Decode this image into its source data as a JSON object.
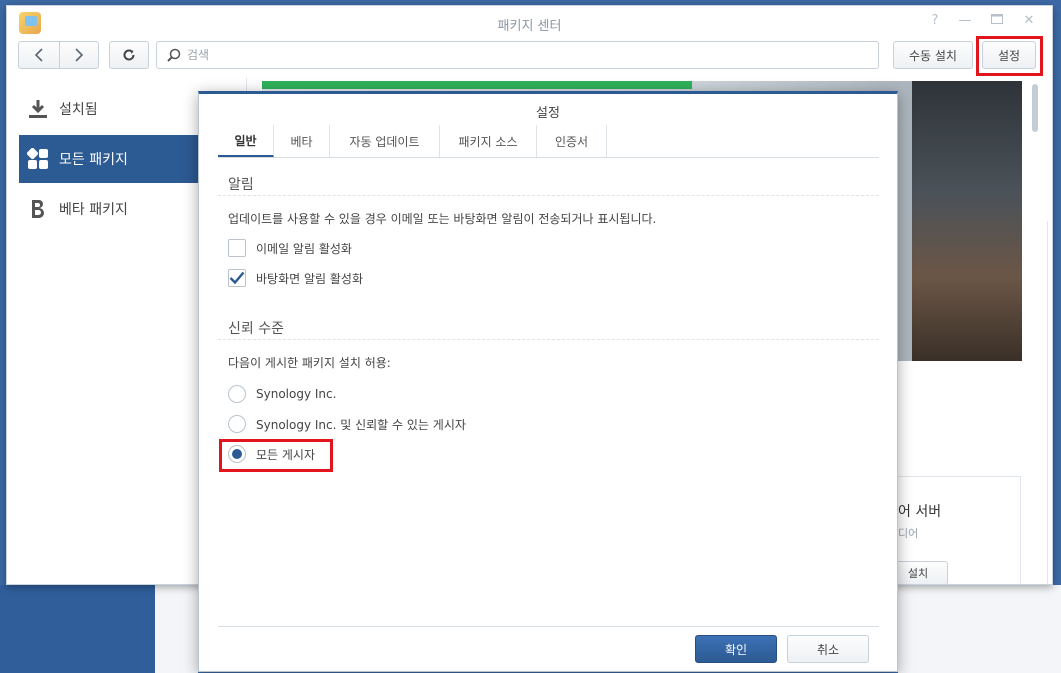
{
  "window": {
    "title": "패키지 센터",
    "controls": [
      "help-icon",
      "minimize-icon",
      "maximize-icon",
      "close-icon"
    ]
  },
  "toolbar": {
    "search_placeholder": "검색",
    "manual_install_label": "수동 설치",
    "settings_label": "설정"
  },
  "sidebar": {
    "items": [
      {
        "label": "설치됨",
        "icon": "download-icon",
        "active": false
      },
      {
        "label": "모든 패키지",
        "icon": "grid-icon",
        "active": true
      },
      {
        "label": "베타 패키지",
        "icon": "beta-icon",
        "active": false
      }
    ]
  },
  "background": {
    "card_title": "어 서버",
    "card_subtitle": "디어",
    "card_button": "설치"
  },
  "dialog": {
    "title": "설정",
    "tabs": [
      {
        "label": "일반",
        "active": true
      },
      {
        "label": "베타",
        "active": false
      },
      {
        "label": "자동 업데이트",
        "active": false
      },
      {
        "label": "패키지 소스",
        "active": false
      },
      {
        "label": "인증서",
        "active": false
      }
    ],
    "notifications": {
      "title": "알림",
      "description": "업데이트를 사용할 수 있을 경우 이메일 또는 바탕화면 알림이 전송되거나 표시됩니다.",
      "options": [
        {
          "label": "이메일 알림 활성화",
          "checked": false
        },
        {
          "label": "바탕화면 알림 활성화",
          "checked": true
        }
      ]
    },
    "trust": {
      "title": "신뢰 수준",
      "description": "다음이 게시한 패키지 설치 허용:",
      "options": [
        {
          "label": "Synology Inc.",
          "selected": false
        },
        {
          "label": "Synology Inc. 및 신뢰할 수 있는 게시자",
          "selected": false
        },
        {
          "label": "모든 게시자",
          "selected": true
        }
      ]
    },
    "ok_label": "확인",
    "cancel_label": "취소"
  },
  "colors": {
    "accent": "#2c5a93",
    "highlight": "#e2141c",
    "banner_green": "#2fb15a"
  }
}
